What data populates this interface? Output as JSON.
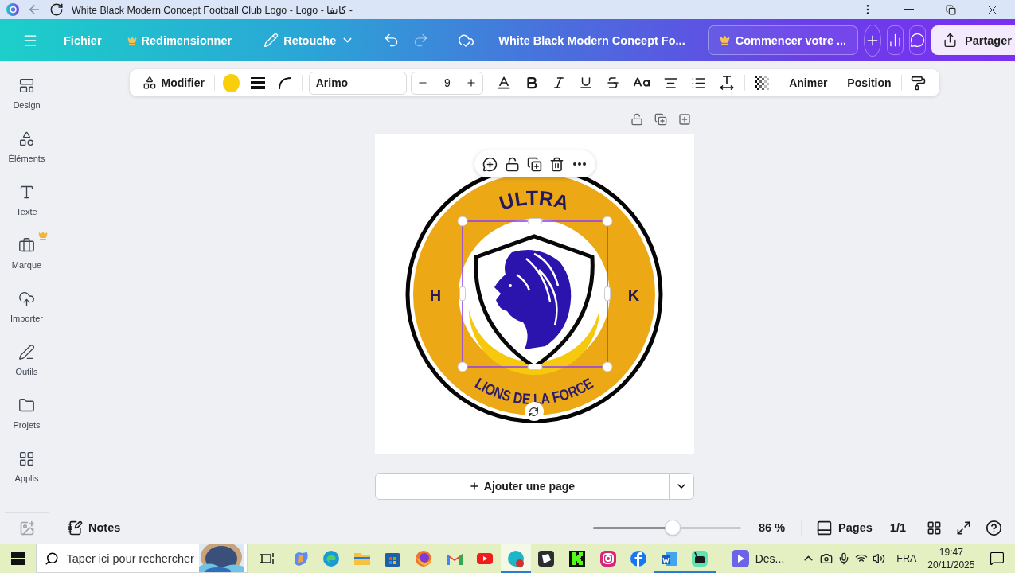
{
  "browser": {
    "title": "White Black Modern Concept Football Club Logo - Logo - كانفا -"
  },
  "header": {
    "file_menu": "Fichier",
    "resize": {
      "label": "Redimensionner",
      "premium": true
    },
    "edit": "Retouche",
    "history": [
      {
        "kind": "undo",
        "disabled": false
      },
      {
        "kind": "redo",
        "disabled": true
      }
    ],
    "document_title": "White Black Modern Concept Fo...",
    "trial": {
      "label": "Commencer votre ...",
      "premium": true
    },
    "share": "Partager"
  },
  "toolbar": {
    "edit": "Modifier",
    "color": "#f8cf0a",
    "font": "Arimo",
    "font_size": "9",
    "animate": "Animer",
    "position": "Position"
  },
  "sidebar": {
    "items": [
      {
        "label": "Design",
        "premium": false
      },
      {
        "label": "Éléments",
        "premium": false
      },
      {
        "label": "Texte",
        "premium": false
      },
      {
        "label": "Marque",
        "premium": true
      },
      {
        "label": "Importer",
        "premium": false
      },
      {
        "label": "Outils",
        "premium": false
      },
      {
        "label": "Projets",
        "premium": false
      },
      {
        "label": "Applis",
        "premium": false
      }
    ]
  },
  "design": {
    "top_text": "ULTRA",
    "left_text": "H",
    "right_text": "K",
    "bottom_text": "LIONS DE LA FORCE"
  },
  "add_page": "Ajouter une page",
  "footer": {
    "notes": "Notes",
    "zoom": {
      "level": 0.54,
      "reading": "86 %"
    },
    "pages": "Pages",
    "page_count": "1/1"
  },
  "taskbar": {
    "search": {
      "placeholder": "Taper ici pour rechercher"
    },
    "apps": [
      {
        "running": false,
        "selected": false
      },
      {
        "running": false,
        "selected": false
      },
      {
        "running": false,
        "selected": false
      },
      {
        "running": false,
        "selected": false
      },
      {
        "running": false,
        "selected": false
      },
      {
        "running": false,
        "selected": false
      },
      {
        "running": false,
        "selected": false
      },
      {
        "running": true,
        "selected": true
      },
      {
        "running": false,
        "selected": false
      },
      {
        "running": false,
        "selected": false
      },
      {
        "running": false,
        "selected": false
      },
      {
        "running": false,
        "selected": false
      },
      {
        "running": true,
        "selected": false
      },
      {
        "running": true,
        "selected": false
      }
    ],
    "active_window": "Des...",
    "language": "FRA",
    "time": "19:47",
    "date": "20/11/2025"
  }
}
